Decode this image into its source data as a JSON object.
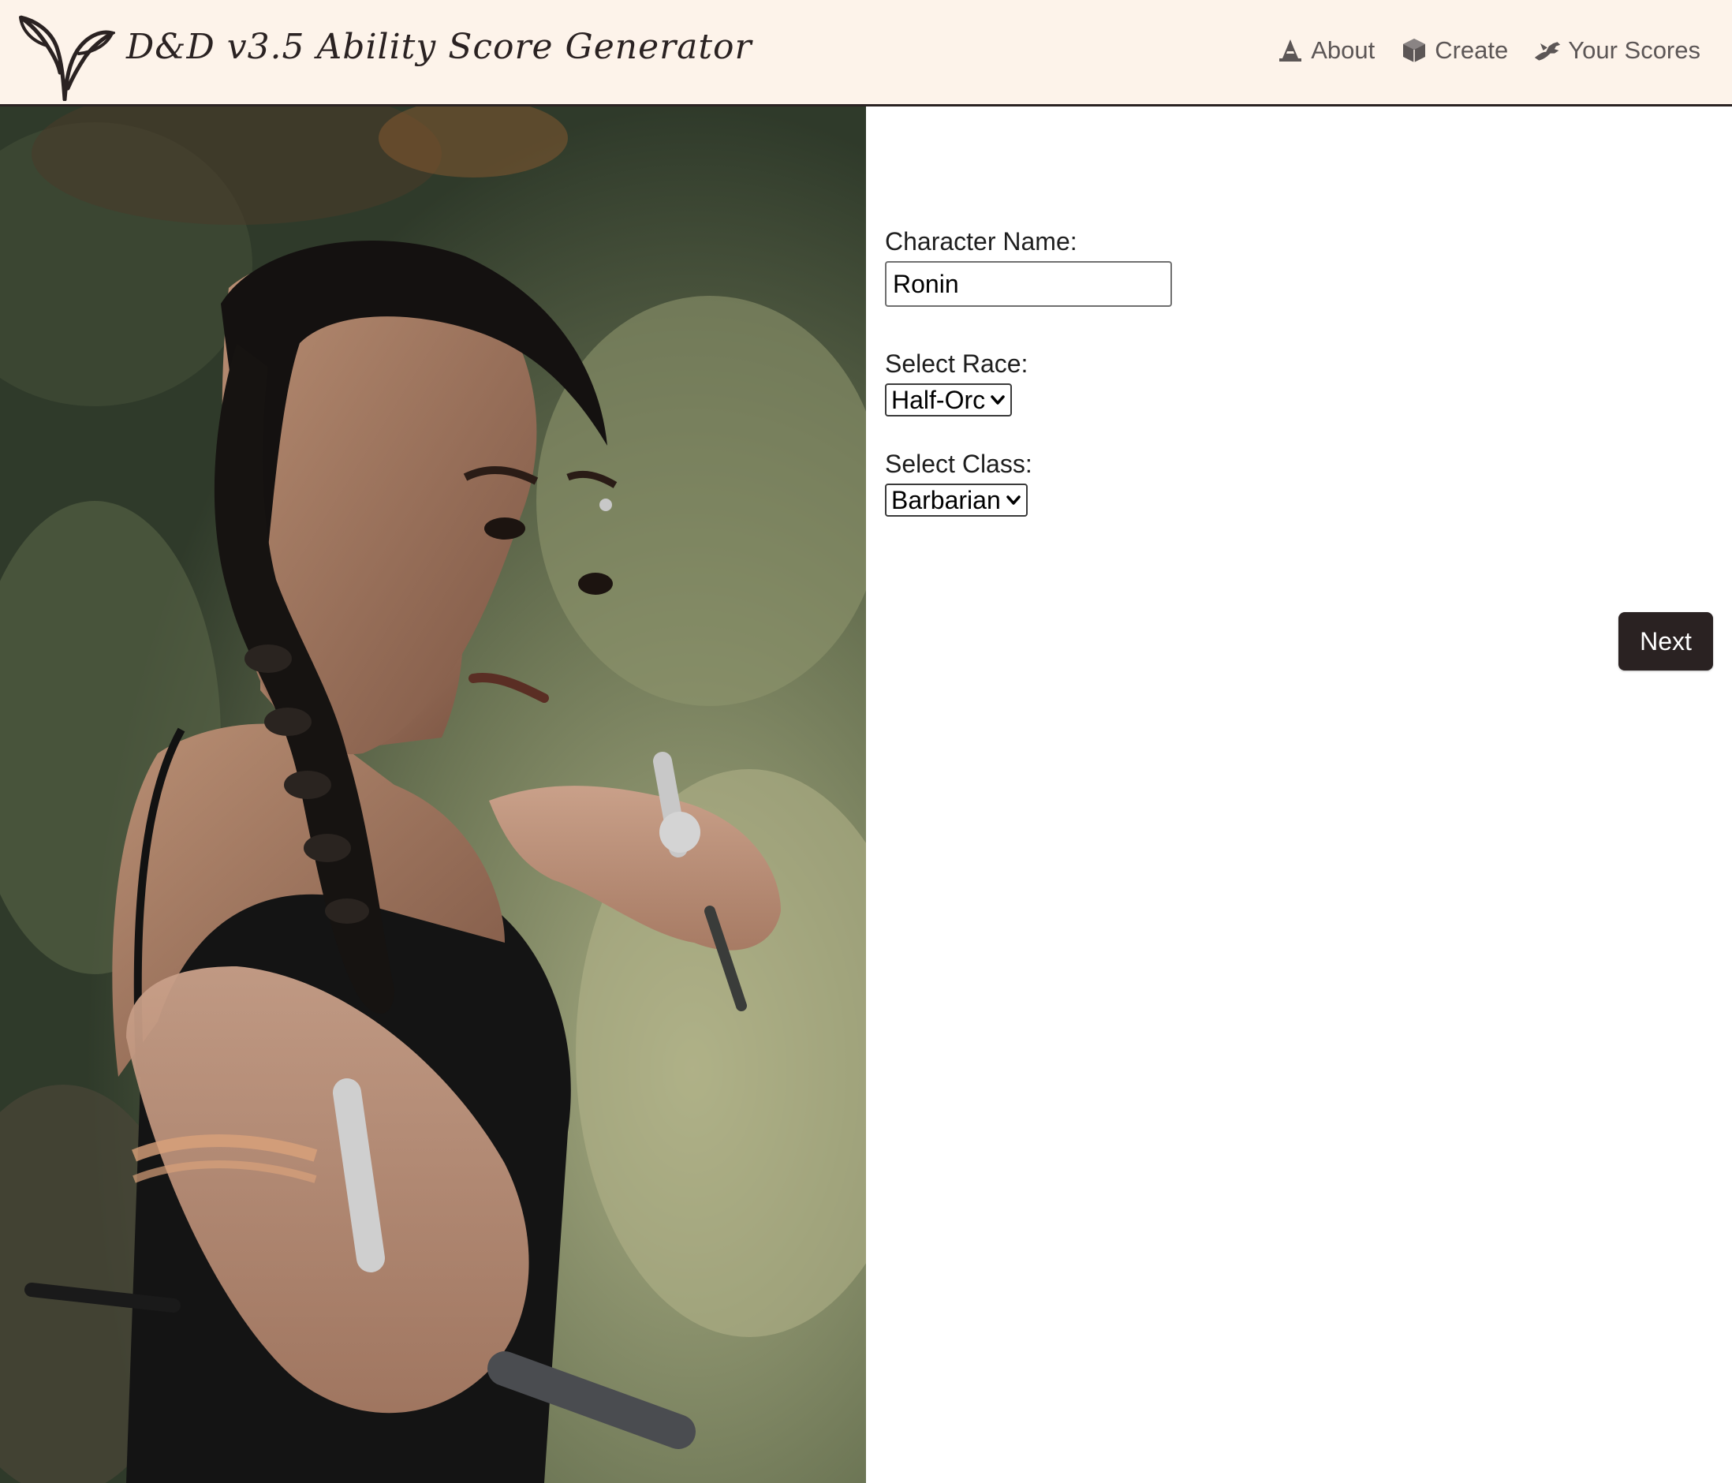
{
  "header": {
    "title": "D&D v3.5 Ability Score Generator",
    "logo_icon": "sprout-icon",
    "nav": [
      {
        "label": "About",
        "icon": "wizard-hat-icon"
      },
      {
        "label": "Create",
        "icon": "dice-icon"
      },
      {
        "label": "Your Scores",
        "icon": "dragon-icon"
      }
    ]
  },
  "hero": {
    "image": "warrior-woman-photo"
  },
  "form": {
    "name_label": "Character Name:",
    "name_value": "Ronin",
    "race_label": "Select Race:",
    "race_value": "Half-Orc",
    "class_label": "Select Class:",
    "class_value": "Barbarian",
    "next_label": "Next"
  },
  "colors": {
    "header_bg": "#fdf3ea",
    "dark": "#2a2222",
    "nav_text": "#5c5656"
  }
}
